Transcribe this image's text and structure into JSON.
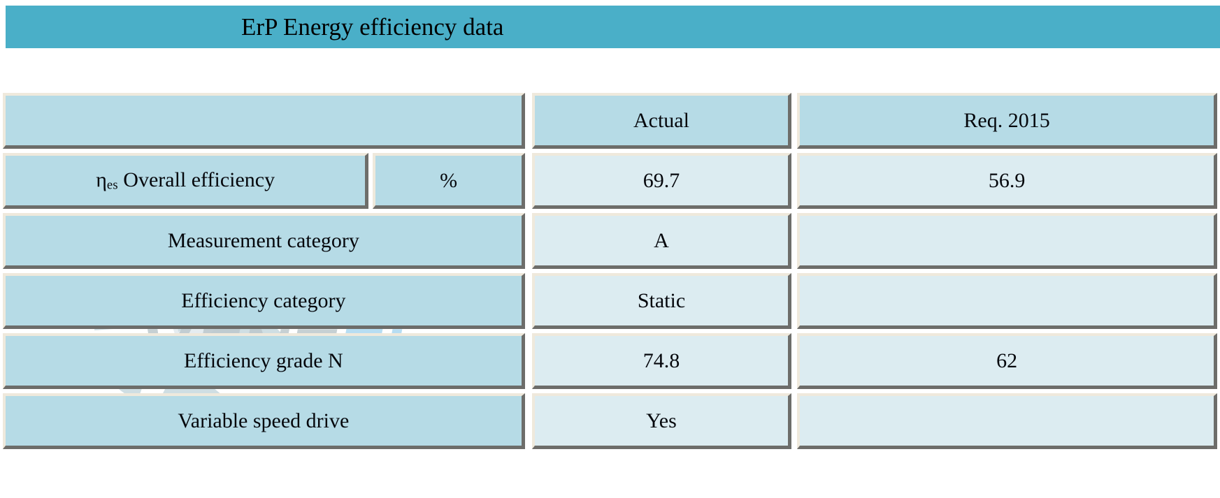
{
  "header": {
    "title": "ErP Energy efficiency data",
    "band_color": "#4aafc8"
  },
  "watermark": {
    "text": "VENTEL",
    "logo_name": "fan-impeller-logo",
    "text_color_primary": "#8fa3aa",
    "text_color_accent": "#7fc4e8"
  },
  "table": {
    "columns": {
      "parameter": "",
      "unit": "",
      "actual": "Actual",
      "required": "Req. 2015"
    },
    "rows": [
      {
        "label_prefix": "η",
        "label_sub": "es",
        "label": " Overall efficiency",
        "unit": "%",
        "actual": "69.7",
        "required": "56.9",
        "has_unit_cell": true
      },
      {
        "label": "Measurement category",
        "unit": "",
        "actual": "A",
        "required": "",
        "has_unit_cell": false
      },
      {
        "label": "Efficiency category",
        "unit": "",
        "actual": "Static",
        "required": "",
        "has_unit_cell": false
      },
      {
        "label": "Efficiency grade N",
        "unit": "",
        "actual": "74.8",
        "required": "62",
        "has_unit_cell": false
      },
      {
        "label": "Variable speed drive",
        "unit": "",
        "actual": "Yes",
        "required": "",
        "has_unit_cell": false
      }
    ]
  },
  "colors": {
    "header_cell_bg": "#b6dbe6",
    "value_cell_bg": "#dcecf1",
    "border_light": "#efe9dc",
    "border_dark": "#6d6d6a",
    "text": "#05070c"
  }
}
